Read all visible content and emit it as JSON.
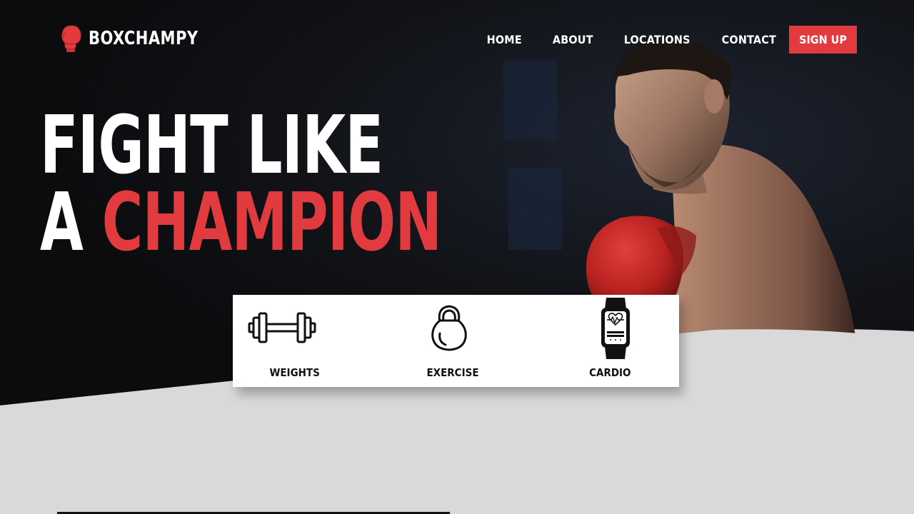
{
  "brand": {
    "name": "BOXCHAMPY",
    "icon": "boxing-glove-icon",
    "icon_color": "#e23b3f"
  },
  "nav": {
    "links": [
      "HOME",
      "ABOUT",
      "LOCATIONS",
      "CONTACT"
    ],
    "cta_label": "SIGN UP",
    "cta_color": "#e23b3f"
  },
  "hero": {
    "line1": "FIGHT LIKE",
    "line2_prefix": "A",
    "line2_accent": "CHAMPION",
    "accent_color": "#e23b3f"
  },
  "features": [
    {
      "label": "WEIGHTS",
      "icon": "dumbbell-icon"
    },
    {
      "label": "EXERCISE",
      "icon": "kettlebell-icon"
    },
    {
      "label": "CARDIO",
      "icon": "smartwatch-icon"
    }
  ],
  "colors": {
    "background_light": "#d9d9d9",
    "background_dark": "#0e0f11"
  }
}
